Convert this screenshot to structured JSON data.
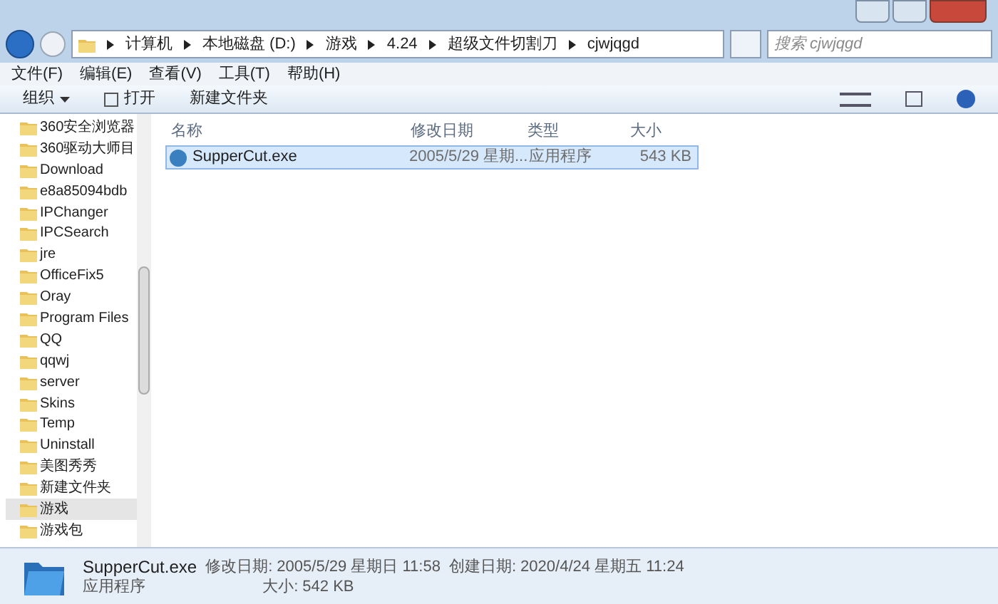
{
  "breadcrumb": [
    "计算机",
    "本地磁盘 (D:)",
    "游戏",
    "4.24",
    "超级文件切割刀",
    "cjwjqgd"
  ],
  "search": {
    "placeholder": "搜索 cjwjqgd"
  },
  "menu": [
    "文件(F)",
    "编辑(E)",
    "查看(V)",
    "工具(T)",
    "帮助(H)"
  ],
  "toolbar": {
    "organize": "组织",
    "open": "打开",
    "new_folder": "新建文件夹"
  },
  "sidebar": {
    "items": [
      {
        "label": "360安全浏览器",
        "selected": false
      },
      {
        "label": "360驱动大师目",
        "selected": false
      },
      {
        "label": "Download",
        "selected": false
      },
      {
        "label": "e8a85094bdb",
        "selected": false
      },
      {
        "label": "IPChanger",
        "selected": false
      },
      {
        "label": "IPCSearch",
        "selected": false
      },
      {
        "label": "jre",
        "selected": false
      },
      {
        "label": "OfficeFix5",
        "selected": false
      },
      {
        "label": "Oray",
        "selected": false
      },
      {
        "label": "Program Files",
        "selected": false
      },
      {
        "label": "QQ",
        "selected": false
      },
      {
        "label": "qqwj",
        "selected": false
      },
      {
        "label": "server",
        "selected": false
      },
      {
        "label": "Skins",
        "selected": false
      },
      {
        "label": "Temp",
        "selected": false
      },
      {
        "label": "Uninstall",
        "selected": false
      },
      {
        "label": "美图秀秀",
        "selected": false
      },
      {
        "label": "新建文件夹",
        "selected": false
      },
      {
        "label": "游戏",
        "selected": true
      },
      {
        "label": "游戏包",
        "selected": false
      }
    ]
  },
  "table": {
    "columns": [
      "名称",
      "修改日期",
      "类型",
      "大小"
    ],
    "rows": [
      {
        "name": "SupperCut.exe",
        "date": "2005/5/29 星期...",
        "type": "应用程序",
        "size": "543 KB",
        "selected": true
      }
    ]
  },
  "details": {
    "name": "SupperCut.exe",
    "type": "应用程序",
    "modified": "修改日期: 2005/5/29 星期日 11:58",
    "created": "创建日期: 2020/4/24 星期五 11:24",
    "size": "大小: 542 KB"
  }
}
